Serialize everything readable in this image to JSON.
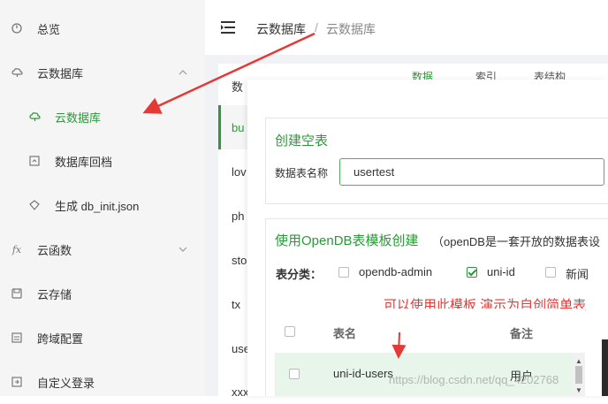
{
  "sidebar": {
    "items": [
      {
        "label": "总览",
        "icon": "dashboard-icon"
      },
      {
        "label": "云数据库",
        "icon": "cloud-db-icon",
        "expanded": true
      },
      {
        "label": "云函数",
        "icon": "fx-icon"
      },
      {
        "label": "云存储",
        "icon": "storage-icon"
      },
      {
        "label": "跨域配置",
        "icon": "cors-icon"
      },
      {
        "label": "自定义登录",
        "icon": "login-icon"
      }
    ],
    "subitems": [
      {
        "label": "云数据库",
        "icon": "cloud-db-icon",
        "active": true
      },
      {
        "label": "数据库回档",
        "icon": "rollback-icon"
      },
      {
        "label": "生成 db_init.json",
        "icon": "generate-icon"
      }
    ],
    "fx_glyph": "fx"
  },
  "header": {
    "crumb_root": "云数据库",
    "crumb_sep": "/",
    "crumb_current": "云数据库"
  },
  "background": {
    "list_header": "数",
    "rows": [
      "bu",
      "lov",
      "ph",
      "sto",
      "tx",
      "use",
      "xxx"
    ],
    "tabs": [
      "数据",
      "索引",
      "表结构"
    ]
  },
  "modal": {
    "section1": {
      "title": "创建空表",
      "field_label": "数据表名称",
      "input_value": "usertest"
    },
    "section2": {
      "title": "使用OpenDB表模板创建",
      "note": "（openDB是一套开放的数据表设",
      "category_label": "表分类：",
      "categories": [
        {
          "label": "opendb-admin",
          "checked": false
        },
        {
          "label": "uni-id",
          "checked": true
        },
        {
          "label": "新闻",
          "checked": false
        }
      ],
      "annotation": "可以使用此模板 演示为自创简单表",
      "table": {
        "headers": [
          "表名",
          "备注"
        ],
        "rows": [
          {
            "name": "uni-id-users",
            "note": "用户"
          }
        ]
      }
    }
  },
  "watermark": "https://blog.csdn.net/qq_4202768",
  "colors": {
    "accent": "#2b9939",
    "annotation": "#e53935"
  }
}
